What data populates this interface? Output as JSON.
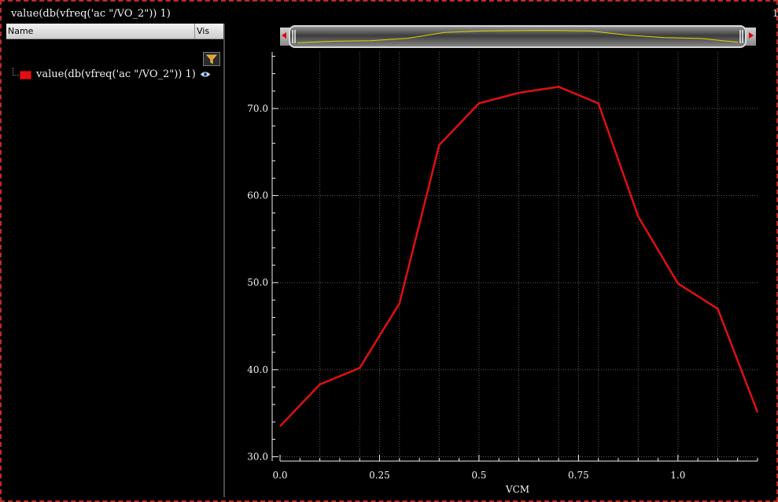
{
  "window": {
    "title": "value(db(vfreq('ac \"/VO_2\")) 1)",
    "corner_number": "1"
  },
  "trace_list": {
    "column_name": "Name",
    "column_vis": "Vis",
    "items": [
      {
        "label": "value(db(vfreq('ac \"/VO_2\")) 1)",
        "color": "#e01010",
        "visible": true
      }
    ],
    "filter_icon": "filter-icon",
    "visibility_icon": "eye-icon"
  },
  "colors": {
    "background": "#000000",
    "trace": "#e01010",
    "grid": "#5a5a5a",
    "overview_trace": "#d8d800"
  },
  "chart_data": {
    "type": "line",
    "xlabel": "VCM",
    "ylabel": "",
    "xlim": [
      0.0,
      1.2
    ],
    "ylim": [
      29.5,
      76.5
    ],
    "xticks": [
      0.0,
      0.25,
      0.5,
      0.75,
      1.0
    ],
    "xtick_labels": [
      "0.0",
      "0.25",
      "0.5",
      "0.75",
      "1.0"
    ],
    "yticks": [
      30.0,
      40.0,
      50.0,
      60.0,
      70.0
    ],
    "ytick_labels": [
      "30.0",
      "40.0",
      "50.0",
      "60.0",
      "70.0"
    ],
    "grid": true,
    "series": [
      {
        "name": "value(db(vfreq('ac \"/VO_2\")) 1)",
        "color": "#e01010",
        "x": [
          0.0,
          0.1,
          0.2,
          0.3,
          0.4,
          0.5,
          0.6,
          0.7,
          0.8,
          0.9,
          1.0,
          1.1,
          1.2
        ],
        "y": [
          33.5,
          38.3,
          40.2,
          47.6,
          65.8,
          70.6,
          71.8,
          72.5,
          70.6,
          57.6,
          49.9,
          47.0,
          35.1
        ]
      }
    ]
  }
}
